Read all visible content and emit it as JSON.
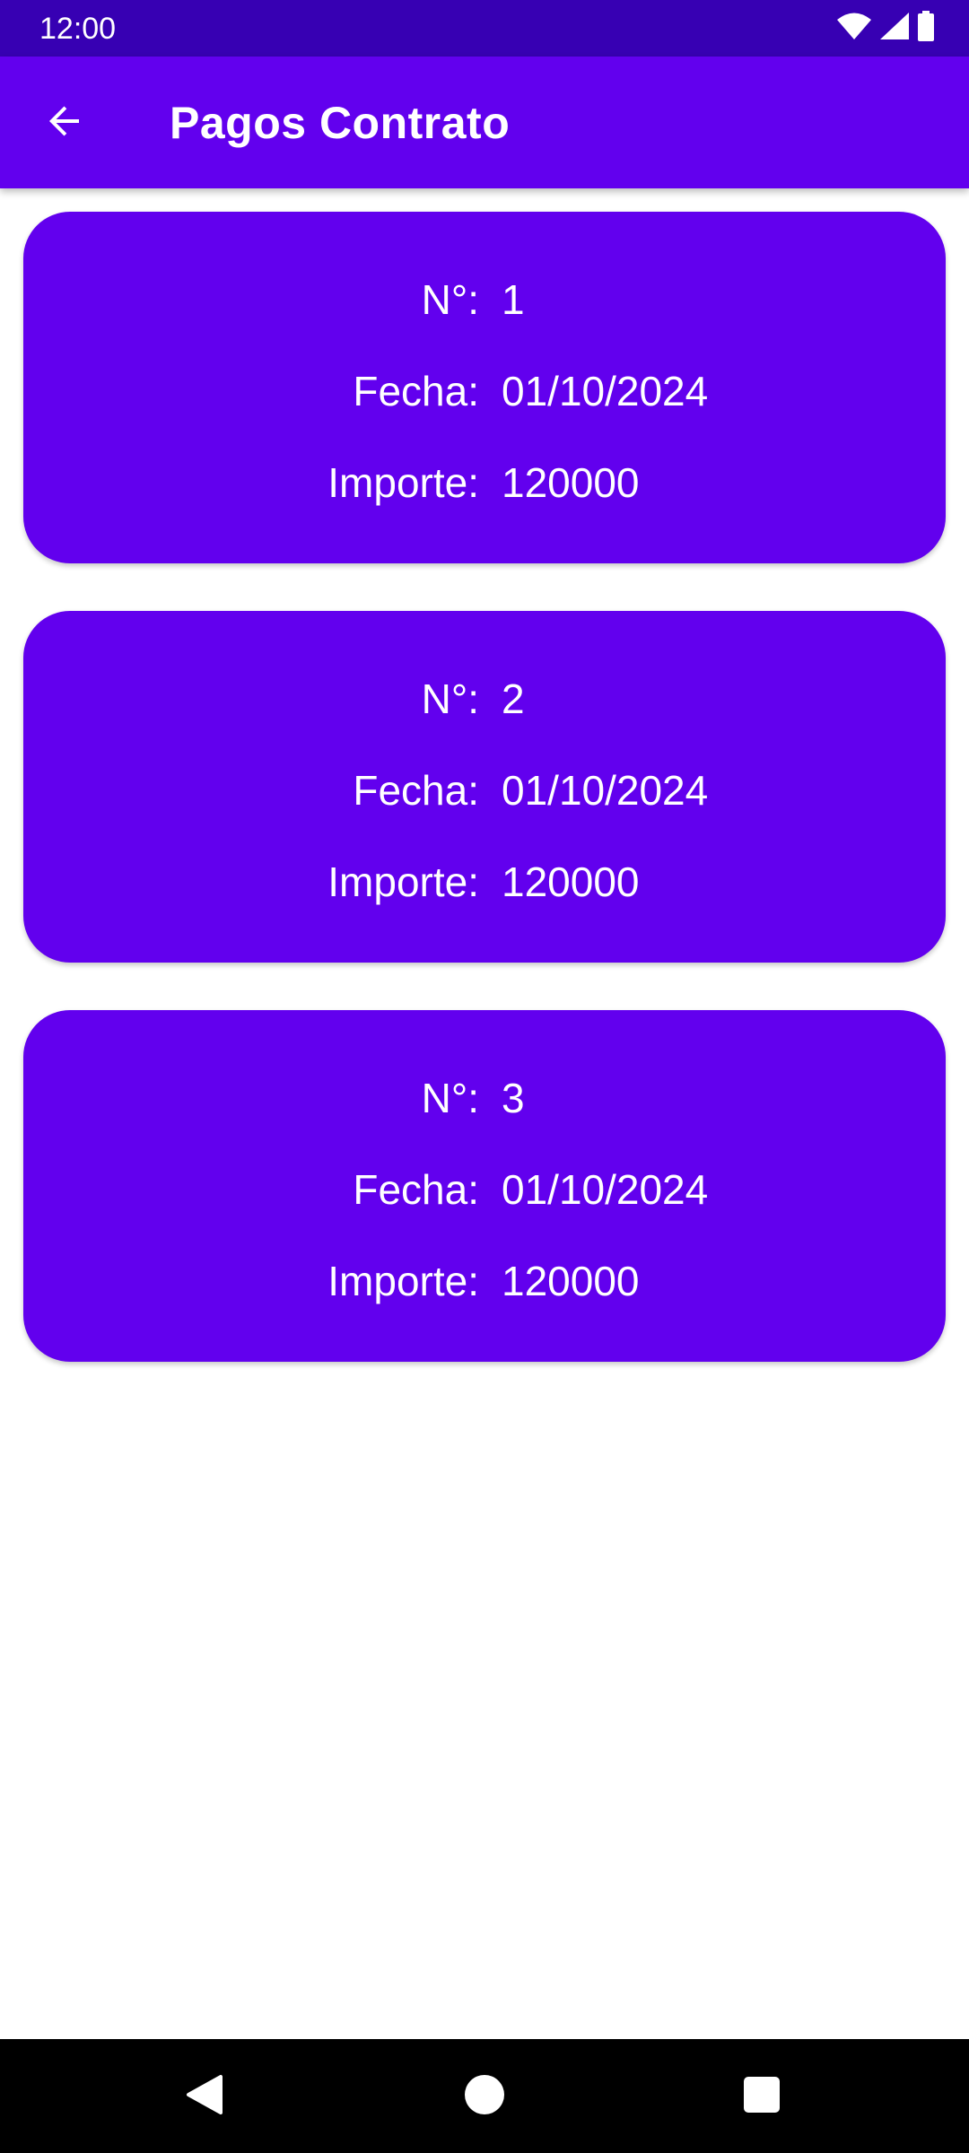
{
  "status_bar": {
    "time": "12:00",
    "icons": [
      "wifi-icon",
      "signal-icon",
      "battery-icon"
    ],
    "background": "#3700B3"
  },
  "app_bar": {
    "title": "Pagos Contrato",
    "back_icon": "arrow-back-icon",
    "background": "#6200EE"
  },
  "payments": [
    {
      "num_label": "N°:",
      "num": "1",
      "fecha_label": "Fecha:",
      "fecha": "01/10/2024",
      "importe_label": "Importe:",
      "importe": "120000"
    },
    {
      "num_label": "N°:",
      "num": "2",
      "fecha_label": "Fecha:",
      "fecha": "01/10/2024",
      "importe_label": "Importe:",
      "importe": "120000"
    },
    {
      "num_label": "N°:",
      "num": "3",
      "fecha_label": "Fecha:",
      "fecha": "01/10/2024",
      "importe_label": "Importe:",
      "importe": "120000"
    }
  ],
  "card_color": "#6200EE",
  "nav_bar": {
    "buttons": [
      "nav-back-icon",
      "nav-home-icon",
      "nav-recents-icon"
    ]
  }
}
